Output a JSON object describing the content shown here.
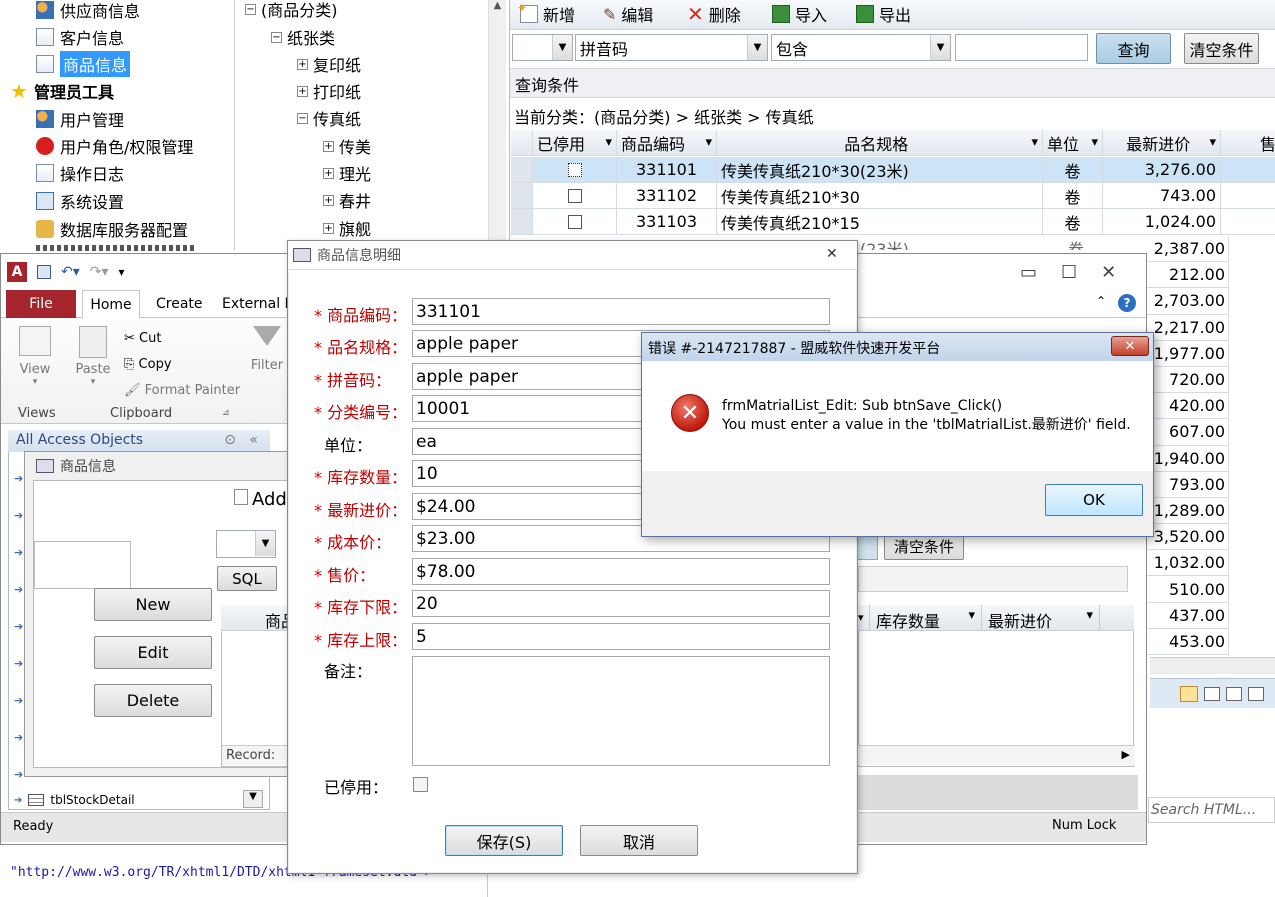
{
  "tree_left": {
    "items": [
      "供应商信息",
      "客户信息",
      "商品信息",
      "管理员工具",
      "用户管理",
      "用户角色/权限管理",
      "操作日志",
      "系统设置",
      "数据库服务器配置"
    ]
  },
  "tree_mid": {
    "root": "(商品分类)",
    "paper": "纸张类",
    "copy": "复印纸",
    "print": "打印纸",
    "fax": "传真纸",
    "b1": "传美",
    "b2": "理光",
    "b3": "春井",
    "b4": "旗舰"
  },
  "toolbar": {
    "add": "新增",
    "edit": "编辑",
    "delete": "删除",
    "import": "导入",
    "export": "导出"
  },
  "filter": {
    "field": "拼音码",
    "op": "包含",
    "value": "",
    "query": "查询",
    "clear": "清空条件"
  },
  "query_label": "查询条件",
  "breadcrumb": "当前分类：(商品分类) > 纸张类 > 传真纸",
  "grid": {
    "headers": [
      "已停用",
      "商品编码",
      "品名规格",
      "单位",
      "最新进价",
      "售"
    ],
    "rows": [
      {
        "code": "331101",
        "name": "传美传真纸210*30(23米)",
        "unit": "卷",
        "price": "3,276.00"
      },
      {
        "code": "331102",
        "name": "传美传真纸210*30",
        "unit": "卷",
        "price": "743.00"
      },
      {
        "code": "331103",
        "name": "传美传真纸210*15",
        "unit": "卷",
        "price": "1,024.00"
      }
    ],
    "extra_prices": [
      "2,387.00",
      "212.00",
      "2,703.00",
      "2,217.00",
      "1,977.00",
      "720.00",
      "420.00",
      "607.00",
      "1,940.00",
      "793.00",
      "1,289.00",
      "3,520.00",
      "1,032.00",
      "510.00",
      "437.00",
      "453.00"
    ],
    "partial_name": "(23米)",
    "partial_unit": "卷"
  },
  "access": {
    "tabs": {
      "file": "File",
      "home": "Home",
      "create": "Create",
      "external": "External Da"
    },
    "clipboard": {
      "cut": "Cut",
      "copy": "Copy",
      "format_painter": "Format Painter",
      "paste": "Paste",
      "group": "Clipboard"
    },
    "view": {
      "label": "View",
      "group": "Views"
    },
    "filter_label": "Filter",
    "nav_title": "All Access Objects",
    "nav_item": "tblStockDetail",
    "status": "Ready",
    "numlock": "Num Lock",
    "search": "Search HTML..."
  },
  "inner_form": {
    "title": "商品信息",
    "new": "New",
    "edit": "Edit",
    "delete": "Delete",
    "add": "Add",
    "sql": "SQL",
    "clear": "清空条件",
    "col_first": "商品",
    "col_qty": "库存数量",
    "col_price": "最新进价",
    "record": "Record:"
  },
  "detail": {
    "title": "商品信息明细",
    "fields": [
      {
        "label": "商品编码：",
        "req": true,
        "value": "331101"
      },
      {
        "label": "品名规格：",
        "req": true,
        "value": "apple paper"
      },
      {
        "label": "拼音码：",
        "req": true,
        "value": "apple paper"
      },
      {
        "label": "分类编号：",
        "req": true,
        "value": "10001"
      },
      {
        "label": "单位：",
        "req": false,
        "value": "ea"
      },
      {
        "label": "库存数量：",
        "req": true,
        "value": "10"
      },
      {
        "label": "最新进价：",
        "req": true,
        "value": "$24.00"
      },
      {
        "label": "成本价：",
        "req": true,
        "value": "$23.00"
      },
      {
        "label": "售价：",
        "req": true,
        "value": "$78.00"
      },
      {
        "label": "库存下限：",
        "req": true,
        "value": "20"
      },
      {
        "label": "库存上限：",
        "req": true,
        "value": "5"
      }
    ],
    "note_label": "备注：",
    "disabled_label": "已停用：",
    "save": "保存(S)",
    "cancel": "取消"
  },
  "error": {
    "title": "错误 #-2147217887 - 盟威软件快速开发平台",
    "line1": "frmMatrialList_Edit: Sub btnSave_Click()",
    "line2": "You must enter a value in the 'tblMatrialList.最新进价' field.",
    "ok": "OK"
  },
  "bottom_code": "\"http://www.w3.org/TR/xhtml1/DTD/xhtml1-frameset.dtd\">"
}
